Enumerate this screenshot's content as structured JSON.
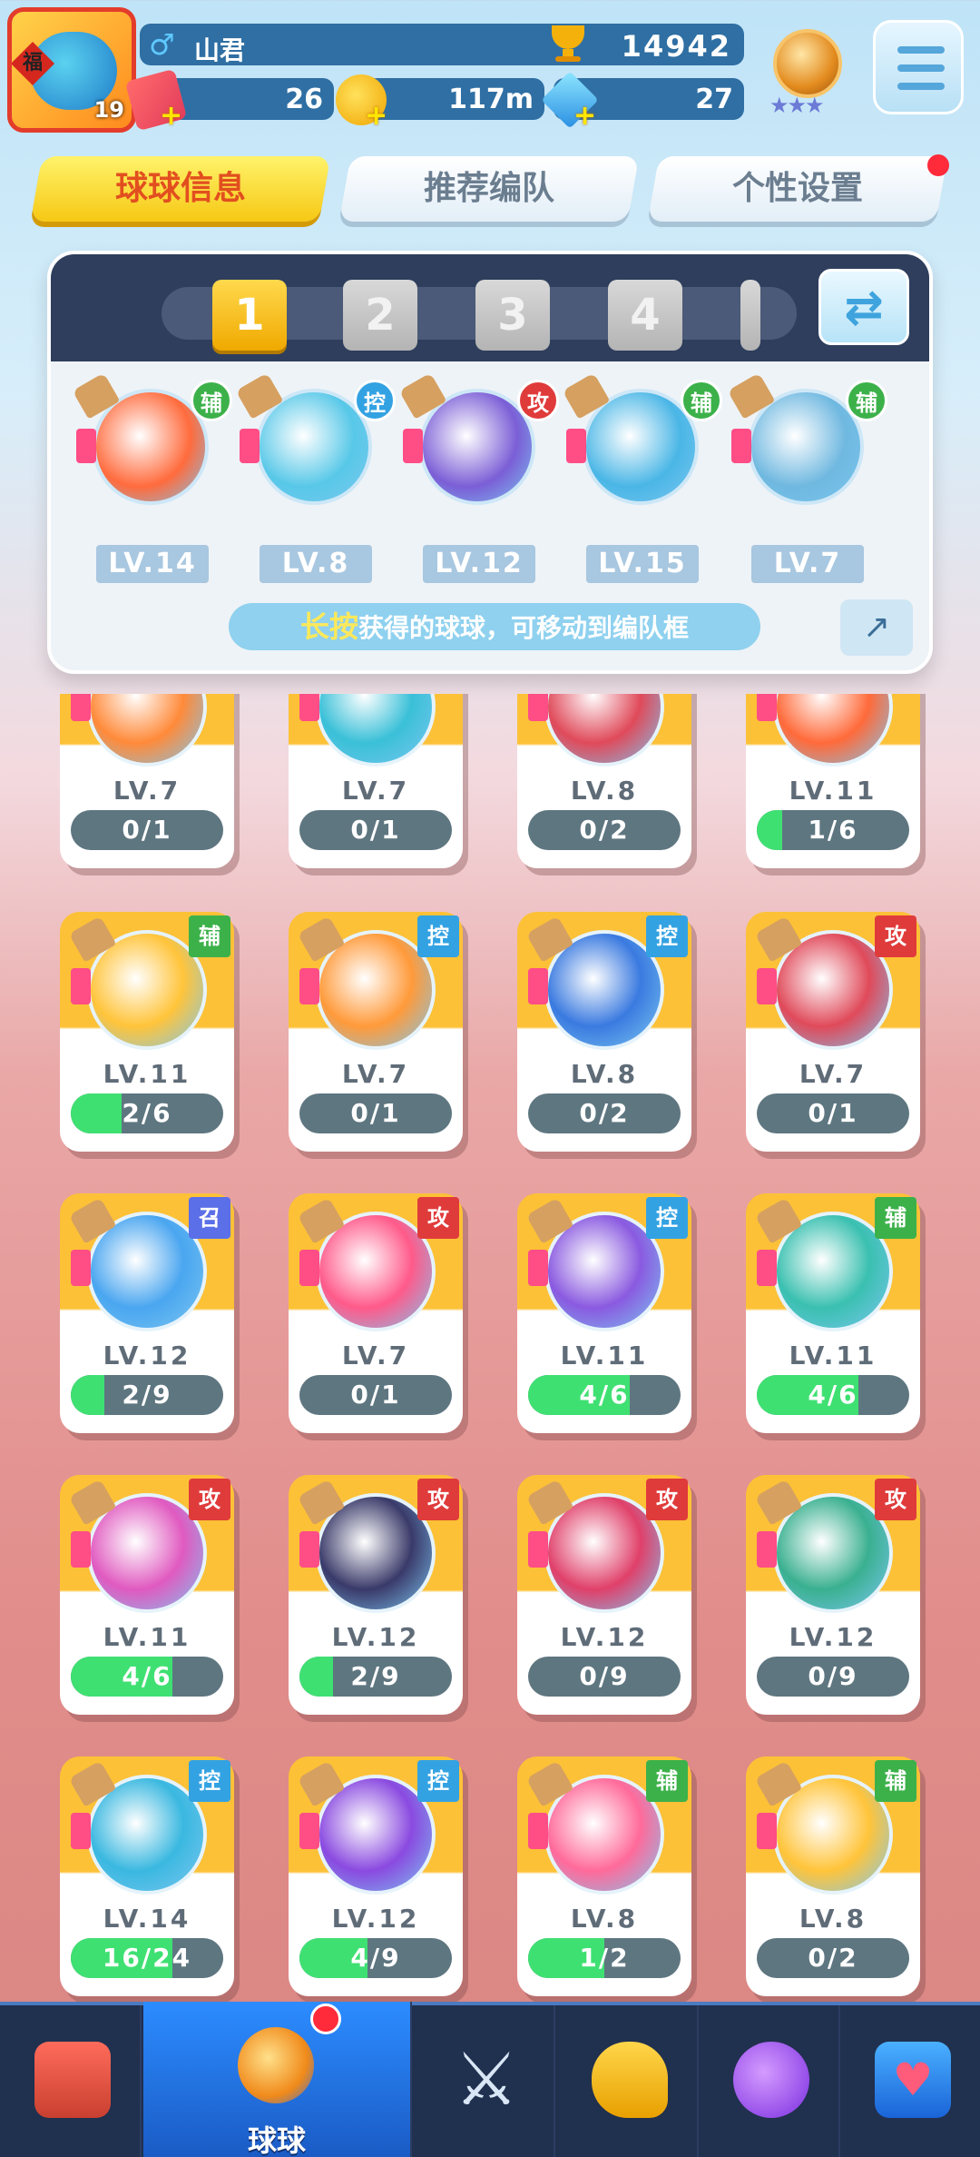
{
  "player": {
    "name": "山君",
    "level": "19",
    "trophies": "14942",
    "tickets": "26",
    "coins": "117m",
    "gems": "27",
    "avatar_char": "福"
  },
  "tabs": [
    "球球信息",
    "推荐编队",
    "个性设置"
  ],
  "team_slots": [
    "1",
    "2",
    "3",
    "4"
  ],
  "team": [
    {
      "type": "辅",
      "lv": "LV.14",
      "color": "#ff6b3d"
    },
    {
      "type": "控",
      "lv": "LV.8",
      "color": "#58c8e8"
    },
    {
      "type": "攻",
      "lv": "LV.12",
      "color": "#7b5ed6"
    },
    {
      "type": "辅",
      "lv": "LV.15",
      "color": "#4ab6e6"
    },
    {
      "type": "辅",
      "lv": "LV.7",
      "color": "#6fb8e0"
    }
  ],
  "hint": {
    "highlight": "长按",
    "text": "获得的球球，可移动到编队框"
  },
  "balls": [
    {
      "type": "",
      "lv": "LV.7",
      "progress": "0/1",
      "fill": 0,
      "color": "#ff8a3a"
    },
    {
      "type": "",
      "lv": "LV.7",
      "progress": "0/1",
      "fill": 0,
      "color": "#3ac0d8"
    },
    {
      "type": "",
      "lv": "LV.8",
      "progress": "0/2",
      "fill": 0,
      "color": "#e04a5a"
    },
    {
      "type": "",
      "lv": "LV.11",
      "progress": "1/6",
      "fill": 0.167,
      "color": "#ff6a3a"
    },
    {
      "type": "辅",
      "lv": "LV.11",
      "progress": "2/6",
      "fill": 0.333,
      "color": "#ffc43a"
    },
    {
      "type": "控",
      "lv": "LV.7",
      "progress": "0/1",
      "fill": 0,
      "color": "#ff9a3a"
    },
    {
      "type": "控",
      "lv": "LV.8",
      "progress": "0/2",
      "fill": 0,
      "color": "#3a7ae0"
    },
    {
      "type": "攻",
      "lv": "LV.7",
      "progress": "0/1",
      "fill": 0,
      "color": "#e04a5a"
    },
    {
      "type": "召",
      "lv": "LV.12",
      "progress": "2/9",
      "fill": 0.222,
      "color": "#4aa6f0"
    },
    {
      "type": "攻",
      "lv": "LV.7",
      "progress": "0/1",
      "fill": 0,
      "color": "#ff5a8a"
    },
    {
      "type": "控",
      "lv": "LV.11",
      "progress": "4/6",
      "fill": 0.667,
      "color": "#8a5ae0"
    },
    {
      "type": "辅",
      "lv": "LV.11",
      "progress": "4/6",
      "fill": 0.667,
      "color": "#3ac0b0"
    },
    {
      "type": "攻",
      "lv": "LV.11",
      "progress": "4/6",
      "fill": 0.667,
      "color": "#e05ac0"
    },
    {
      "type": "攻",
      "lv": "LV.12",
      "progress": "2/9",
      "fill": 0.222,
      "color": "#3a3a6a"
    },
    {
      "type": "攻",
      "lv": "LV.12",
      "progress": "0/9",
      "fill": 0,
      "color": "#e0406a"
    },
    {
      "type": "攻",
      "lv": "LV.12",
      "progress": "0/9",
      "fill": 0,
      "color": "#3ab090"
    },
    {
      "type": "控",
      "lv": "LV.14",
      "progress": "16/24",
      "fill": 0.667,
      "color": "#3ab8e0"
    },
    {
      "type": "控",
      "lv": "LV.12",
      "progress": "4/9",
      "fill": 0.444,
      "color": "#8a4ae0"
    },
    {
      "type": "辅",
      "lv": "LV.8",
      "progress": "1/2",
      "fill": 0.5,
      "color": "#ff6a9a"
    },
    {
      "type": "辅",
      "lv": "LV.8",
      "progress": "0/2",
      "fill": 0,
      "color": "#ffc43a"
    }
  ],
  "badge_colors": {
    "辅": "#3cb14a",
    "控": "#33a2e2",
    "攻": "#e03b3b",
    "召": "#5b6fe8"
  },
  "nav": [
    {
      "label": "",
      "icon": "shop-icon"
    },
    {
      "label": "球球",
      "icon": "ball-icon"
    },
    {
      "label": "",
      "icon": "swords-icon"
    },
    {
      "label": "",
      "icon": "whistle-icon"
    },
    {
      "label": "",
      "icon": "planet-icon"
    },
    {
      "label": "",
      "icon": "chat-icon"
    }
  ]
}
